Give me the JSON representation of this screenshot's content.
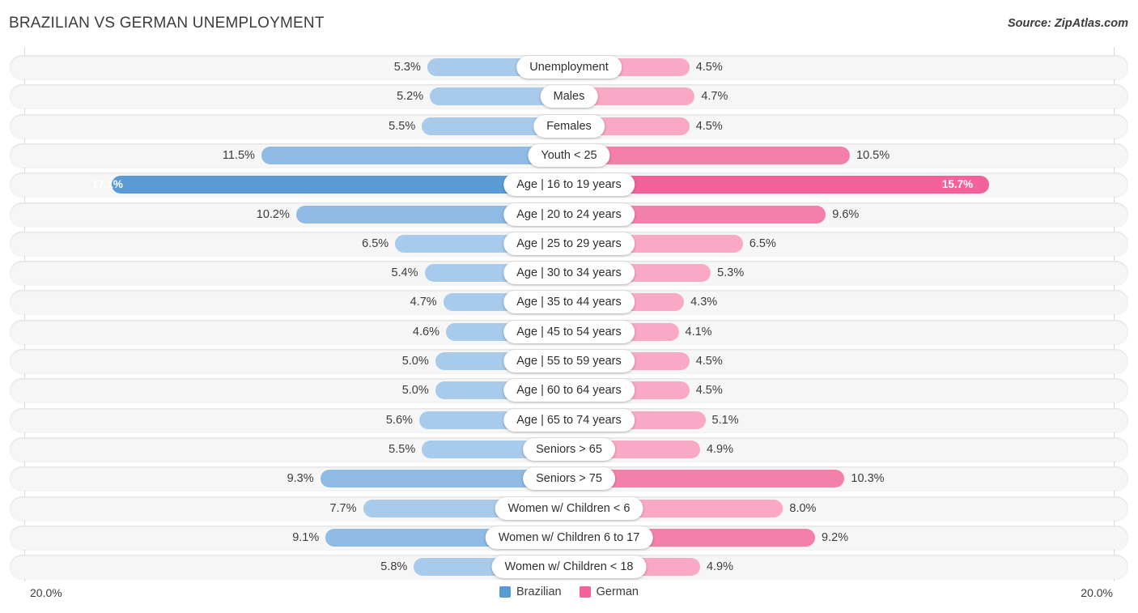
{
  "header": {
    "title": "BRAZILIAN VS GERMAN UNEMPLOYMENT",
    "source": "Source: ZipAtlas.com"
  },
  "axis": {
    "min_label": "20.0%",
    "max_label": "20.0%",
    "max_value": 20.0
  },
  "legend": [
    {
      "label": "Brazilian",
      "color": "#5b9bd5"
    },
    {
      "label": "German",
      "color": "#f3629a"
    }
  ],
  "colors": {
    "blue_light": "#a8cbeb",
    "blue_mid": "#8ebae4",
    "blue_dark": "#5b9bd5",
    "pink_light": "#f9a8c5",
    "pink_mid": "#f57fab",
    "pink_dark": "#f3629a",
    "track": "#f6f6f6",
    "text": "#3c3c3c"
  },
  "chart_data": {
    "type": "bar",
    "title": "BRAZILIAN VS GERMAN UNEMPLOYMENT",
    "subtitle": "",
    "xlabel": "",
    "ylabel": "",
    "orientation": "horizontal-diverging",
    "xlim": [
      0,
      20.0
    ],
    "grid": false,
    "legend_position": "bottom-center",
    "categories": [
      "Unemployment",
      "Males",
      "Females",
      "Youth < 25",
      "Age | 16 to 19 years",
      "Age | 20 to 24 years",
      "Age | 25 to 29 years",
      "Age | 30 to 34 years",
      "Age | 35 to 44 years",
      "Age | 45 to 54 years",
      "Age | 55 to 59 years",
      "Age | 60 to 64 years",
      "Age | 65 to 74 years",
      "Seniors > 65",
      "Seniors > 75",
      "Women w/ Children < 6",
      "Women w/ Children 6 to 17",
      "Women w/ Children < 18"
    ],
    "series": [
      {
        "name": "Brazilian",
        "values": [
          5.3,
          5.2,
          5.5,
          11.5,
          17.1,
          10.2,
          6.5,
          5.4,
          4.7,
          4.6,
          5.0,
          5.0,
          5.6,
          5.5,
          9.3,
          7.7,
          9.1,
          5.8
        ],
        "labels": [
          "5.3%",
          "5.2%",
          "5.5%",
          "11.5%",
          "17.1%",
          "10.2%",
          "6.5%",
          "5.4%",
          "4.7%",
          "4.6%",
          "5.0%",
          "5.0%",
          "5.6%",
          "5.5%",
          "9.3%",
          "7.7%",
          "9.1%",
          "5.8%"
        ]
      },
      {
        "name": "German",
        "values": [
          4.5,
          4.7,
          4.5,
          10.5,
          15.7,
          9.6,
          6.5,
          5.3,
          4.3,
          4.1,
          4.5,
          4.5,
          5.1,
          4.9,
          10.3,
          8.0,
          9.2,
          4.9
        ],
        "labels": [
          "4.5%",
          "4.7%",
          "4.5%",
          "10.5%",
          "15.7%",
          "9.6%",
          "6.5%",
          "5.3%",
          "4.3%",
          "4.1%",
          "4.5%",
          "4.5%",
          "5.1%",
          "4.9%",
          "10.3%",
          "8.0%",
          "9.2%",
          "4.9%"
        ]
      }
    ]
  },
  "rows": [
    {
      "label": "Unemployment",
      "left_value": 5.3,
      "left_label": "5.3%",
      "right_value": 4.5,
      "right_label": "4.5%",
      "left_shade": "blue",
      "right_shade": "pink",
      "left_inside": false,
      "right_inside": false
    },
    {
      "label": "Males",
      "left_value": 5.2,
      "left_label": "5.2%",
      "right_value": 4.7,
      "right_label": "4.7%",
      "left_shade": "blue",
      "right_shade": "pink",
      "left_inside": false,
      "right_inside": false
    },
    {
      "label": "Females",
      "left_value": 5.5,
      "left_label": "5.5%",
      "right_value": 4.5,
      "right_label": "4.5%",
      "left_shade": "blue",
      "right_shade": "pink",
      "left_inside": false,
      "right_inside": false
    },
    {
      "label": "Youth < 25",
      "left_value": 11.5,
      "left_label": "11.5%",
      "right_value": 10.5,
      "right_label": "10.5%",
      "left_shade": "blue-mid",
      "right_shade": "pink-mid",
      "left_inside": false,
      "right_inside": false
    },
    {
      "label": "Age | 16 to 19 years",
      "left_value": 17.1,
      "left_label": "17.1%",
      "right_value": 15.7,
      "right_label": "15.7%",
      "left_shade": "blue-dark",
      "right_shade": "pink-dark",
      "left_inside": true,
      "right_inside": true
    },
    {
      "label": "Age | 20 to 24 years",
      "left_value": 10.2,
      "left_label": "10.2%",
      "right_value": 9.6,
      "right_label": "9.6%",
      "left_shade": "blue-mid",
      "right_shade": "pink-mid",
      "left_inside": false,
      "right_inside": false
    },
    {
      "label": "Age | 25 to 29 years",
      "left_value": 6.5,
      "left_label": "6.5%",
      "right_value": 6.5,
      "right_label": "6.5%",
      "left_shade": "blue",
      "right_shade": "pink",
      "left_inside": false,
      "right_inside": false
    },
    {
      "label": "Age | 30 to 34 years",
      "left_value": 5.4,
      "left_label": "5.4%",
      "right_value": 5.3,
      "right_label": "5.3%",
      "left_shade": "blue",
      "right_shade": "pink",
      "left_inside": false,
      "right_inside": false
    },
    {
      "label": "Age | 35 to 44 years",
      "left_value": 4.7,
      "left_label": "4.7%",
      "right_value": 4.3,
      "right_label": "4.3%",
      "left_shade": "blue",
      "right_shade": "pink",
      "left_inside": false,
      "right_inside": false
    },
    {
      "label": "Age | 45 to 54 years",
      "left_value": 4.6,
      "left_label": "4.6%",
      "right_value": 4.1,
      "right_label": "4.1%",
      "left_shade": "blue",
      "right_shade": "pink",
      "left_inside": false,
      "right_inside": false
    },
    {
      "label": "Age | 55 to 59 years",
      "left_value": 5.0,
      "left_label": "5.0%",
      "right_value": 4.5,
      "right_label": "4.5%",
      "left_shade": "blue",
      "right_shade": "pink",
      "left_inside": false,
      "right_inside": false
    },
    {
      "label": "Age | 60 to 64 years",
      "left_value": 5.0,
      "left_label": "5.0%",
      "right_value": 4.5,
      "right_label": "4.5%",
      "left_shade": "blue",
      "right_shade": "pink",
      "left_inside": false,
      "right_inside": false
    },
    {
      "label": "Age | 65 to 74 years",
      "left_value": 5.6,
      "left_label": "5.6%",
      "right_value": 5.1,
      "right_label": "5.1%",
      "left_shade": "blue",
      "right_shade": "pink",
      "left_inside": false,
      "right_inside": false
    },
    {
      "label": "Seniors > 65",
      "left_value": 5.5,
      "left_label": "5.5%",
      "right_value": 4.9,
      "right_label": "4.9%",
      "left_shade": "blue",
      "right_shade": "pink",
      "left_inside": false,
      "right_inside": false
    },
    {
      "label": "Seniors > 75",
      "left_value": 9.3,
      "left_label": "9.3%",
      "right_value": 10.3,
      "right_label": "10.3%",
      "left_shade": "blue-mid",
      "right_shade": "pink-mid",
      "left_inside": false,
      "right_inside": false
    },
    {
      "label": "Women w/ Children < 6",
      "left_value": 7.7,
      "left_label": "7.7%",
      "right_value": 8.0,
      "right_label": "8.0%",
      "left_shade": "blue",
      "right_shade": "pink",
      "left_inside": false,
      "right_inside": false
    },
    {
      "label": "Women w/ Children 6 to 17",
      "left_value": 9.1,
      "left_label": "9.1%",
      "right_value": 9.2,
      "right_label": "9.2%",
      "left_shade": "blue-mid",
      "right_shade": "pink-mid",
      "left_inside": false,
      "right_inside": false
    },
    {
      "label": "Women w/ Children < 18",
      "left_value": 5.8,
      "left_label": "5.8%",
      "right_value": 4.9,
      "right_label": "4.9%",
      "left_shade": "blue",
      "right_shade": "pink",
      "left_inside": false,
      "right_inside": false
    }
  ]
}
